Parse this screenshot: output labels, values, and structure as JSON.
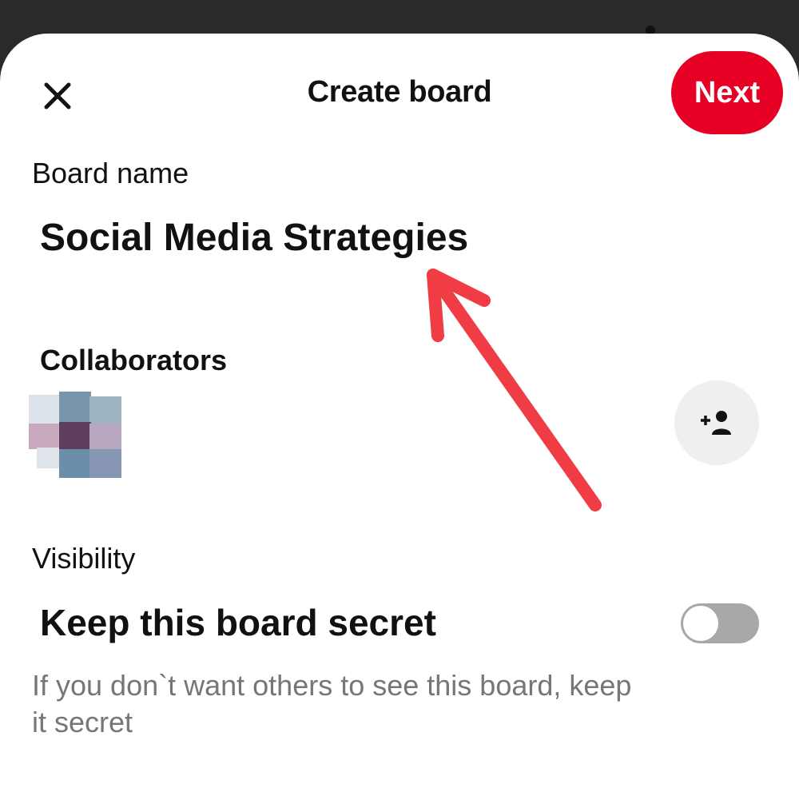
{
  "header": {
    "title": "Create board",
    "next_label": "Next"
  },
  "board_name": {
    "label": "Board name",
    "value": "Social Media Strategies"
  },
  "collaborators": {
    "label": "Collaborators"
  },
  "visibility": {
    "label": "Visibility",
    "secret_title": "Keep this board secret",
    "secret_description": "If you don`t want others to see this board, keep it secret",
    "secret_enabled": false
  },
  "colors": {
    "accent": "#e60023",
    "annotation": "#f03c45"
  }
}
